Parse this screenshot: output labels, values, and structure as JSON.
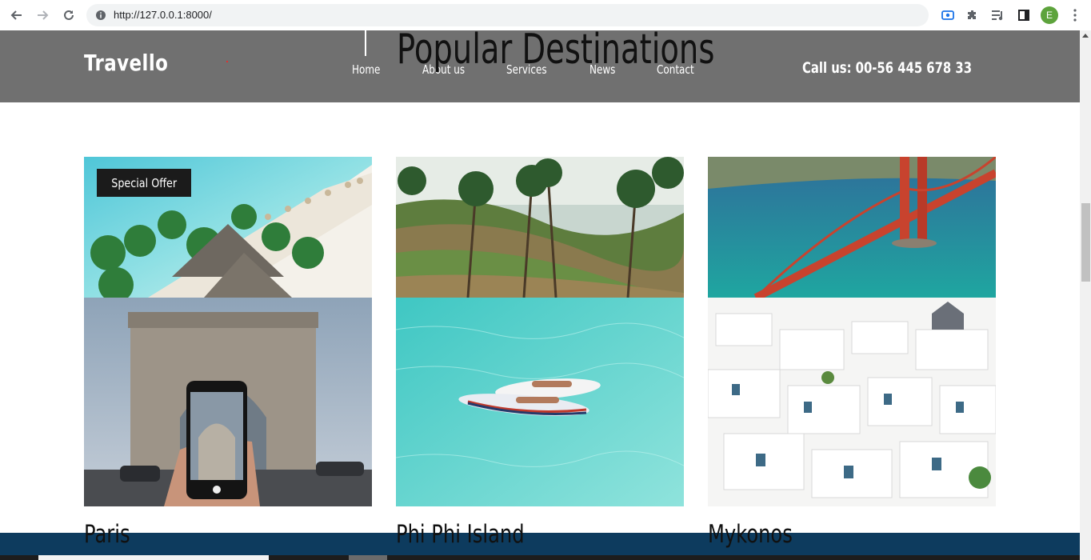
{
  "browser": {
    "url": "http://127.0.0.1:8000/",
    "profile_initial": "E"
  },
  "header": {
    "logo": "Travello",
    "nav": [
      "Home",
      "About us",
      "Services",
      "News",
      "Contact"
    ],
    "call": "Call us: 00-56 445 678 33"
  },
  "section": {
    "title": "Popular Destinations"
  },
  "cards": [
    {
      "badge": "Special Offer",
      "title": "Paris"
    },
    {
      "title": "Phi Phi Island"
    },
    {
      "title": "Mykonos"
    }
  ],
  "colors": {
    "header_bg": "#707070",
    "footer_bg": "#0d3b5e",
    "badge_bg": "#1b1b1b"
  }
}
